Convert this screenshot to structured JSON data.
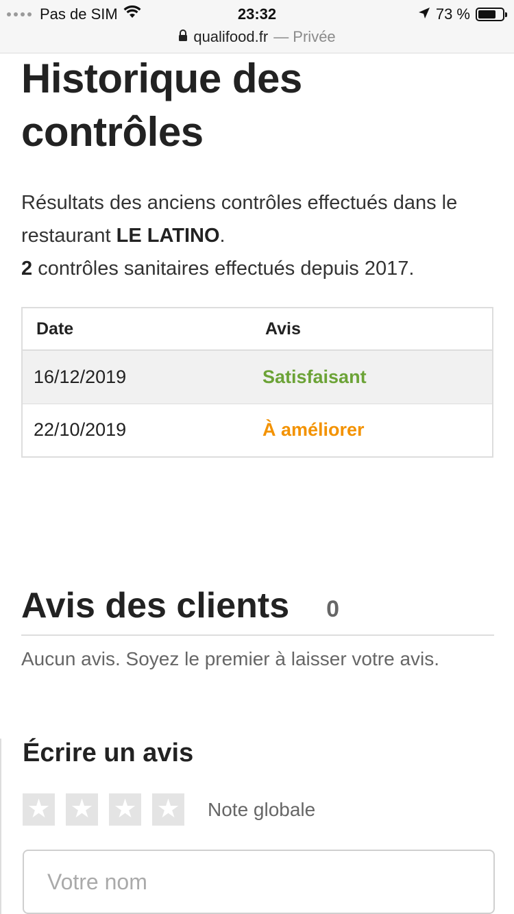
{
  "status_bar": {
    "carrier": "Pas de SIM",
    "time": "23:32",
    "battery": "73 %",
    "battery_level": 0.73
  },
  "url_bar": {
    "domain": "qualifood.fr",
    "mode": "— Privée"
  },
  "history": {
    "title": "Historique des contrôles",
    "intro_prefix": "Résultats des anciens contrôles effectués dans le restaurant ",
    "restaurant": "LE LATINO",
    "intro_suffix": ".",
    "count": "2",
    "count_text": " contrôles sanitaires effectués depuis 2017.",
    "table": {
      "headers": [
        "Date",
        "Avis"
      ],
      "rows": [
        {
          "date": "16/12/2019",
          "verdict": "Satisfaisant",
          "color": "#6ca337"
        },
        {
          "date": "22/10/2019",
          "verdict": "À améliorer",
          "color": "#f39200"
        }
      ]
    }
  },
  "reviews": {
    "title": "Avis des clients",
    "count": "0",
    "empty_message": "Aucun avis. Soyez le premier à laisser votre avis."
  },
  "write_review": {
    "title": "Écrire un avis",
    "stars": 4,
    "rating_label": "Note globale",
    "name_placeholder": "Votre nom"
  }
}
